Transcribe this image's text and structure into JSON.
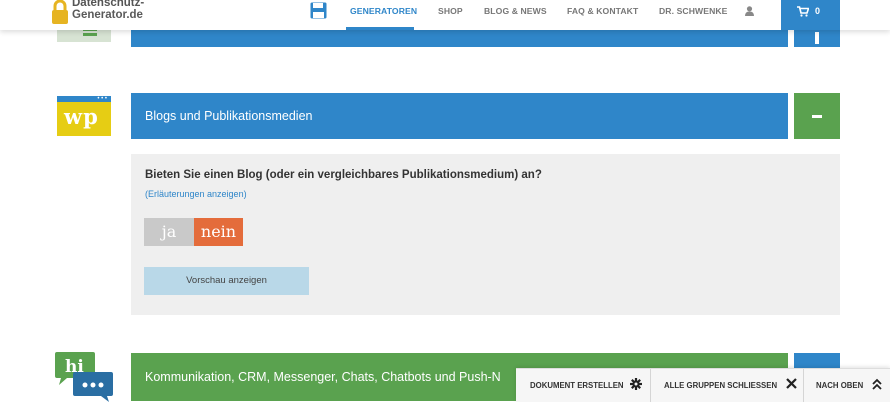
{
  "header": {
    "logo_line1": "Datenschutz-",
    "logo_line2": "Generator.de",
    "nav": [
      "GENERATOREN",
      "SHOP",
      "BLOG & NEWS",
      "FAQ & KONTAKT",
      "DR. SCHWENKE"
    ],
    "active_nav": "GENERATOREN",
    "cart_count": "0",
    "colors": {
      "accent": "#2f86c9",
      "green": "#5aa24f",
      "orange": "#e46c3b"
    }
  },
  "section_blogs": {
    "icon_text": "wp",
    "title": "Blogs und Publikationsmedien",
    "toggle": "−",
    "question": "Bieten Sie einen Blog (oder ein vergleichbares Publikationsmedium) an?",
    "explanation_link": "(Erläuterungen anzeigen)",
    "yes_label": "ja",
    "no_label": "nein",
    "selected": "nein",
    "preview_button": "Vorschau anzeigen"
  },
  "section_chat": {
    "icon_text": "hi",
    "title": "Kommunikation, CRM, Messenger, Chats, Chatbots und Push-N"
  },
  "actions": {
    "create": "DOKUMENT ERSTELLEN",
    "close_all": "ALLE GRUPPEN SCHLIESSEN",
    "to_top": "NACH OBEN"
  },
  "icons": [
    "lock-logo-icon",
    "save-icon",
    "user-icon",
    "cart-icon",
    "gear-icon",
    "close-icon",
    "double-chevron-up-icon"
  ]
}
